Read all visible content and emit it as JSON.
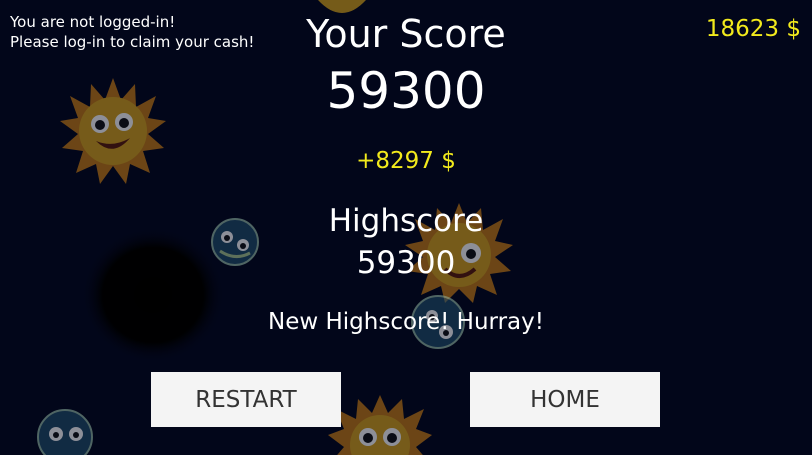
{
  "login_notice": {
    "line1": "You are not logged-in!",
    "line2": "Please log-in to claim your cash!"
  },
  "cash_total": "18623 $",
  "score": {
    "title": "Your Score",
    "value": "59300"
  },
  "cash_earned": "+8297 $",
  "highscore": {
    "title": "Highscore",
    "value": "59300",
    "message": "New Highscore! Hurray!"
  },
  "buttons": {
    "restart_label": "RESTART",
    "home_label": "HOME"
  },
  "colors": {
    "background": "#02061a",
    "cash_yellow": "#f2ea1c",
    "text_white": "#ffffff",
    "button_bg": "#f4f4f4",
    "button_text": "#333333"
  },
  "background_sprites": [
    "sun-face-sprite",
    "blue-orb-sprite",
    "black-hole-sprite"
  ]
}
